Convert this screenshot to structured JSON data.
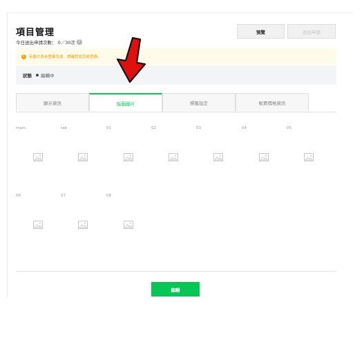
{
  "header": {
    "title": "項目管理",
    "submit_count": "今日送出申請次數： 0／30次",
    "help_icon": "?"
  },
  "toolbar": {
    "preview_label": "預覽",
    "submit_label": "送出申請"
  },
  "warning": {
    "icon": "!",
    "text": "有圖片尚未登錄完成，請確認並完成登錄。"
  },
  "status": {
    "label": "狀態",
    "value": "編輯中"
  },
  "tabs": [
    {
      "label": "顯示資訊",
      "active": false
    },
    {
      "label": "貼圖圖片",
      "active": true
    },
    {
      "label": "標籤設定",
      "active": false
    },
    {
      "label": "販賣價格資訊",
      "active": false
    }
  ],
  "image_slots": [
    {
      "label": "main"
    },
    {
      "label": "tab"
    },
    {
      "label": "01"
    },
    {
      "label": "02"
    },
    {
      "label": "03"
    },
    {
      "label": "04"
    },
    {
      "label": "05"
    },
    {
      "label": "06"
    },
    {
      "label": "07"
    },
    {
      "label": "08"
    }
  ],
  "footer": {
    "edit_label": "編輯"
  },
  "colors": {
    "accent": "#06c755",
    "warning": "#f29b00",
    "arrow": "#e01010"
  },
  "icons": {
    "slot_placeholder": "image-placeholder-icon",
    "annotation": "red-arrow-icon"
  }
}
